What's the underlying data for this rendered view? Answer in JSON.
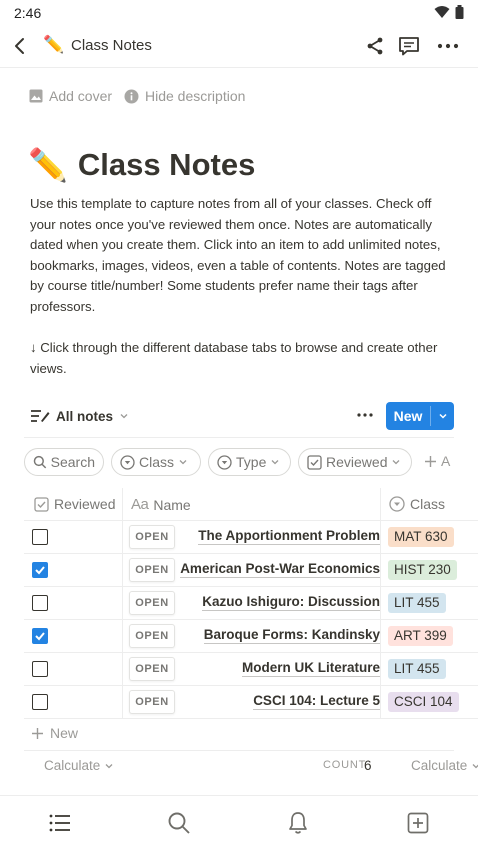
{
  "status_bar": {
    "time": "2:46"
  },
  "header": {
    "emoji": "✏️",
    "title": "Class Notes"
  },
  "page_meta": {
    "add_cover": "Add cover",
    "hide_description": "Hide description"
  },
  "page": {
    "emoji": "✏️",
    "title": "Class Notes",
    "description": "Use this template to capture notes from all of your classes. Check off your notes once you've reviewed them once. Notes are automatically dated when you create them. Click into an item to add unlimited notes, bookmarks, images, videos, even a table of contents. Notes are tagged by course title/number! Some students prefer name their tags after professors.",
    "tip": "↓ Click through the different database tabs to browse and create other views."
  },
  "database": {
    "view_label": "All notes",
    "new_label": "New",
    "filters": [
      {
        "label": "Search"
      },
      {
        "label": "Class"
      },
      {
        "label": "Type"
      },
      {
        "label": "Reviewed"
      }
    ],
    "add_filter": "A",
    "columns": {
      "reviewed": "Reviewed",
      "name": "Name",
      "class": "Class"
    },
    "open_label": "OPEN",
    "rows": [
      {
        "checked": false,
        "name": "The Apportionment Problem",
        "class": "MAT 630",
        "class_color": "#fadec9"
      },
      {
        "checked": true,
        "name": "American Post-War Economics",
        "class": "HIST 230",
        "class_color": "#dbeddb"
      },
      {
        "checked": false,
        "name": "Kazuo Ishiguro: Discussion",
        "class": "LIT 455",
        "class_color": "#d3e5ef"
      },
      {
        "checked": true,
        "name": "Baroque Forms: Kandinsky",
        "class": "ART 399",
        "class_color": "#ffe2dd"
      },
      {
        "checked": false,
        "name": "Modern UK Literature",
        "class": "LIT 455",
        "class_color": "#d3e5ef"
      },
      {
        "checked": false,
        "name": "CSCI 104: Lecture 5",
        "class": "CSCI 104",
        "class_color": "#e8deee"
      }
    ],
    "new_row_label": "New",
    "calculate_label": "Calculate",
    "count_label": "COUNT",
    "count_value": "6"
  },
  "colors": {
    "accent": "#2383e2",
    "text": "#37352f",
    "muted": "#9b9a97"
  }
}
